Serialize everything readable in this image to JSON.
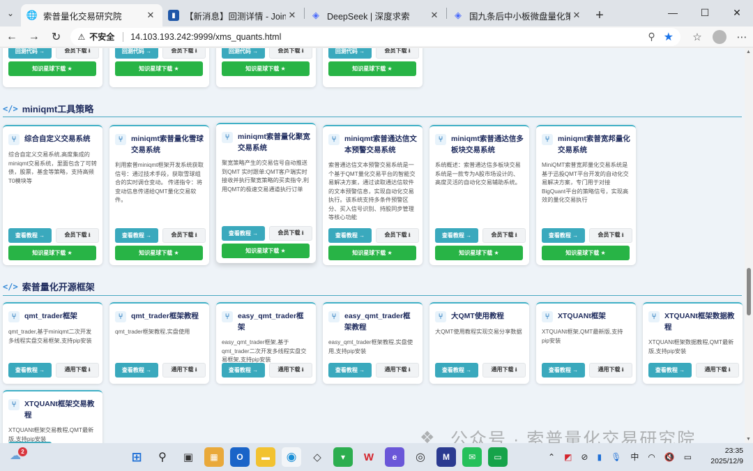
{
  "browser": {
    "tabs": [
      {
        "label": "索普量化交易研究院",
        "active": true,
        "favicon": "globe-icon"
      },
      {
        "label": "【新消息】回测详情 - JoinQuant",
        "active": false,
        "favicon": "chart-icon"
      },
      {
        "label": "DeepSeek | 深度求索",
        "active": false,
        "favicon": "whale-icon"
      },
      {
        "label": "国九条后中小板微盘量化策略分析",
        "active": false,
        "favicon": "whale-icon"
      }
    ],
    "insecure_label": "不安全",
    "url": "14.103.193.242:9999/xms_quants.html"
  },
  "top_row": {
    "cards": [
      {
        "btn1": "回测代码 →",
        "btn2": "会员下载 ⭳",
        "btn3": "知识星球下载 ★"
      },
      {
        "btn1": "回测代码 →",
        "btn2": "会员下载 ⭳",
        "btn3": "知识星球下载 ★"
      },
      {
        "btn1": "回测代码 →",
        "btn2": "会员下载 ⭳",
        "btn3": "知识星球下载 ★"
      },
      {
        "btn1": "回测代码 →",
        "btn2": "会员下载 ⭳",
        "btn3": "知识星球下载 ★"
      }
    ]
  },
  "section_miniqmt": {
    "title": "miniqmt工具策略",
    "cards": [
      {
        "title": "综合自定义交易系统",
        "desc": "综合自定义交易系统,高度集成的miniqmt交易系统，里面包含了可转债，股票，基金等策略，支持高频T0模块等",
        "btn1": "查看教程 →",
        "btn2": "会员下载 ⭳",
        "btn3": "知识星球下载 ★"
      },
      {
        "title": "miniqmt索普量化雪球交易系统",
        "desc": "利用索普miniqmt框架开发系统获取信号：通过技术手段，获取雪球组合的实时调仓变动。 传递指令：将变动信息传递给QMT量化交易软件。",
        "btn1": "查看教程 →",
        "btn2": "会员下载 ⭳",
        "btn3": "知识星球下载 ★"
      },
      {
        "title": "miniqmt索普量化聚宽交易系统",
        "desc": "聚宽策略产生的交易信号自动推送到QMT 实时跟单:QMT客户端实时接收并执行聚宽策略的买卖指令,利用QMT的极速交易通道执行订单",
        "btn1": "查看教程 →",
        "btn2": "会员下载 ⭳",
        "btn3": "知识星球下载 ★"
      },
      {
        "title": "miniqmt索普通达信文本预警交易系统",
        "desc": "索普通达信文本预警交易系统是一个基于QMT量化交易平台的智能交易解决方案，通过读取通达信软件的文本预警信息，实现自动化交易执行。该系统支持多条件预警区分、买入信号识别、持股同步管理等核心功能",
        "btn1": "查看教程 →",
        "btn2": "会员下载 ⭳",
        "btn3": "知识星球下载 ★"
      },
      {
        "title": "miniqmt索普通达信多板块交易系统",
        "desc": "系统概述：索普通达信多板块交易系统是一款专为A股市场设计的、高度灵活的自动化交易辅助系统。",
        "btn1": "查看教程 →",
        "btn2": "会员下载 ⭳",
        "btn3": "知识星球下载 ★"
      },
      {
        "title": "miniqmt索普宽邦量化交易系统",
        "desc": "MiniQMT索普宽邦量化交易系统是基于迅投QMT平台开发的自动化交易解决方案，专门用于对接BigQuant平台的策略信号，实现高效的量化交易执行",
        "btn1": "查看教程 →",
        "btn2": "会员下载 ⭳",
        "btn3": "知识星球下载 ★"
      }
    ]
  },
  "section_open": {
    "title": "索普量化开源框架",
    "cards": [
      {
        "title": "qmt_trader框架",
        "desc": "qmt_trader,基于miniqmt二次开发多线程实盘交易框架,支持pip安装",
        "btn1": "查看教程 →",
        "btn2": "通用下载 ⭳"
      },
      {
        "title": "qmt_trader框架教程",
        "desc": "qmt_trader框架教程,实盘使用",
        "btn1": "查看教程 →",
        "btn2": "通用下载 ⭳"
      },
      {
        "title": "easy_qmt_trader框架",
        "desc": "easy_qmt_trader框架,基于qmt_trader二次开发多线程实盘交易框架,支持pip安装",
        "btn1": "查看教程 →",
        "btn2": "通用下载 ⭳"
      },
      {
        "title": "easy_qmt_trader框架教程",
        "desc": "easy_qmt_trader框架教程,实盘使用,支持pip安装",
        "btn1": "查看教程 →",
        "btn2": "通用下载 ⭳"
      },
      {
        "title": "大QMT使用教程",
        "desc": "大QMT使用教程实现交易分享数据",
        "btn1": "查看教程 →",
        "btn2": "通用下载 ⭳"
      },
      {
        "title": "XTQUANt框架",
        "desc": "XTQUANt框架,QMT最新版,支持pip安装",
        "btn1": "查看教程 →",
        "btn2": "通用下载 ⭳"
      },
      {
        "title": "XTQUANt框架数据教程",
        "desc": "XTQUANt框架数据教程,QMT最新版,支持pip安装",
        "btn1": "查看教程 →",
        "btn2": "通用下载 ⭳"
      },
      {
        "title": "XTQUANt框架交易教程",
        "desc": "XTQUANt框架交易教程,QMT最新版,支持pip安装"
      }
    ]
  },
  "watermark": "公众号 · 索普量化交易研究院",
  "taskbar": {
    "weather_badge": "2",
    "ime": "中",
    "time": "23:35",
    "date": "2025/12/9"
  }
}
